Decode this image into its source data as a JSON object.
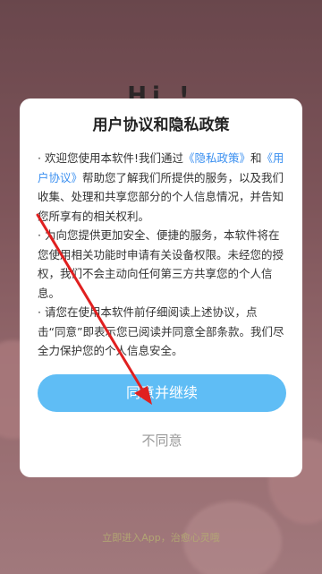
{
  "background": {
    "title": "Hi !",
    "footer": "立即进入App，治愈心灵哦"
  },
  "dialog": {
    "title": "用户协议和隐私政策",
    "para1": {
      "pre": "· 欢迎您使用本软件!我们通过",
      "link_privacy": "《隐私政策》",
      "mid": "和",
      "link_user": "《用户协议》",
      "post": "帮助您了解我们所提供的服务，以及我们收集、处理和共享您部分的个人信息情况，并告知您所享有的相关权利。"
    },
    "para2": "· 为向您提供更加安全、便捷的服务，本软件将在您使用相关功能时申请有关设备权限。未经您的授权，我们不会主动向任何第三方共享您的个人信息。",
    "para3": "· 请您在使用本软件前仔细阅读上述协议，点击“同意”即表示您已阅读并同意全部条款。我们尽全力保护您的个人信息安全。",
    "agree_label": "同意并继续",
    "disagree_label": "不同意"
  },
  "colors": {
    "accent": "#5fbdf5",
    "link": "#3a8ff0",
    "annotation_arrow": "#e02020"
  }
}
